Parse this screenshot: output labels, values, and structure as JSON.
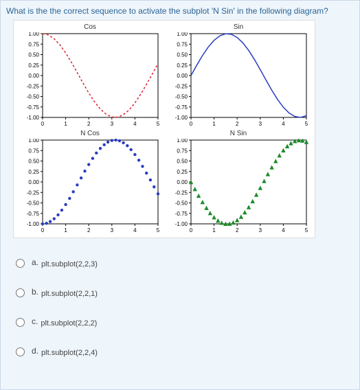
{
  "question": "What is the the correct sequence to activate the subplot 'N Sin' in the following diagram?",
  "chart_data": [
    {
      "type": "line",
      "title": "Cos",
      "xlim": [
        0,
        5
      ],
      "ylim": [
        -1,
        1
      ],
      "xticks": [
        0,
        1,
        2,
        3,
        4,
        5
      ],
      "yticks": [
        -1.0,
        -0.75,
        -0.5,
        -0.25,
        0.0,
        0.25,
        0.5,
        0.75,
        1.0
      ],
      "style": "dashed",
      "color": "#d9232e",
      "x": [
        0.0,
        0.25,
        0.5,
        0.75,
        1.0,
        1.25,
        1.5,
        1.75,
        2.0,
        2.25,
        2.5,
        2.75,
        3.0,
        3.25,
        3.5,
        3.75,
        4.0,
        4.25,
        4.5,
        4.75,
        5.0
      ],
      "y": [
        1.0,
        0.969,
        0.878,
        0.732,
        0.54,
        0.315,
        0.071,
        -0.178,
        -0.416,
        -0.628,
        -0.801,
        -0.924,
        -0.99,
        -0.994,
        -0.936,
        -0.821,
        -0.654,
        -0.446,
        -0.211,
        0.035,
        0.284
      ]
    },
    {
      "type": "line",
      "title": "Sin",
      "xlim": [
        0,
        5
      ],
      "ylim": [
        -1,
        1
      ],
      "xticks": [
        0,
        1,
        2,
        3,
        4,
        5
      ],
      "yticks": [
        -1.0,
        -0.75,
        -0.5,
        -0.25,
        0.0,
        0.25,
        0.5,
        0.75,
        1.0
      ],
      "style": "solid",
      "color": "#2a3cc1",
      "x": [
        0.0,
        0.25,
        0.5,
        0.75,
        1.0,
        1.25,
        1.5,
        1.75,
        2.0,
        2.25,
        2.5,
        2.75,
        3.0,
        3.25,
        3.5,
        3.75,
        4.0,
        4.25,
        4.5,
        4.75,
        5.0
      ],
      "y": [
        0.0,
        0.247,
        0.479,
        0.682,
        0.841,
        0.949,
        0.997,
        0.984,
        0.909,
        0.778,
        0.599,
        0.382,
        0.141,
        -0.108,
        -0.351,
        -0.572,
        -0.757,
        -0.895,
        -0.978,
        -0.999,
        -0.959
      ]
    },
    {
      "type": "scatter",
      "title": "N Cos",
      "xlim": [
        0,
        5
      ],
      "ylim": [
        -1,
        1
      ],
      "xticks": [
        0,
        1,
        2,
        3,
        4,
        5
      ],
      "yticks": [
        -1.0,
        -0.75,
        -0.5,
        -0.25,
        0.0,
        0.25,
        0.5,
        0.75,
        1.0
      ],
      "marker": "dot",
      "color": "#2a3cc1",
      "x": [
        0.0,
        0.17,
        0.33,
        0.5,
        0.67,
        0.83,
        1.0,
        1.17,
        1.33,
        1.5,
        1.67,
        1.83,
        2.0,
        2.17,
        2.33,
        2.5,
        2.67,
        2.83,
        3.0,
        3.17,
        3.33,
        3.5,
        3.67,
        3.83,
        4.0,
        4.17,
        4.33,
        4.5,
        4.67,
        4.83,
        5.0
      ],
      "y": [
        -1.0,
        -0.986,
        -0.946,
        -0.878,
        -0.786,
        -0.673,
        -0.54,
        -0.393,
        -0.235,
        -0.071,
        0.096,
        0.259,
        0.416,
        0.562,
        0.691,
        0.801,
        0.889,
        0.951,
        0.99,
        1.0,
        0.982,
        0.936,
        0.866,
        0.771,
        0.654,
        0.52,
        0.372,
        0.211,
        0.048,
        -0.117,
        -0.284
      ]
    },
    {
      "type": "scatter",
      "title": "N Sin",
      "xlim": [
        0,
        5
      ],
      "ylim": [
        -1,
        1
      ],
      "xticks": [
        0,
        1,
        2,
        3,
        4,
        5
      ],
      "yticks": [
        -1.0,
        -0.75,
        -0.5,
        -0.25,
        0.0,
        0.25,
        0.5,
        0.75,
        1.0
      ],
      "marker": "triangle",
      "color": "#1c8a2c",
      "x": [
        0.0,
        0.17,
        0.33,
        0.5,
        0.67,
        0.83,
        1.0,
        1.17,
        1.33,
        1.5,
        1.67,
        1.83,
        2.0,
        2.17,
        2.33,
        2.5,
        2.67,
        2.83,
        3.0,
        3.17,
        3.33,
        3.5,
        3.67,
        3.83,
        4.0,
        4.17,
        4.33,
        4.5,
        4.67,
        4.83,
        5.0
      ],
      "y": [
        0.0,
        -0.166,
        -0.327,
        -0.479,
        -0.618,
        -0.74,
        -0.841,
        -0.92,
        -0.972,
        -0.997,
        -0.995,
        -0.966,
        -0.909,
        -0.828,
        -0.723,
        -0.599,
        -0.457,
        -0.303,
        -0.141,
        0.025,
        0.19,
        0.351,
        0.501,
        0.637,
        0.757,
        0.855,
        0.928,
        0.978,
        0.999,
        0.992,
        0.959
      ]
    }
  ],
  "options": [
    {
      "letter": "a.",
      "text": "plt.subplot(2,2,3)"
    },
    {
      "letter": "b.",
      "text": "plt.subplot(2,2,1)"
    },
    {
      "letter": "c.",
      "text": "plt.subplot(2,2,2)"
    },
    {
      "letter": "d.",
      "text": "plt.subplot(2,2,4)"
    }
  ]
}
